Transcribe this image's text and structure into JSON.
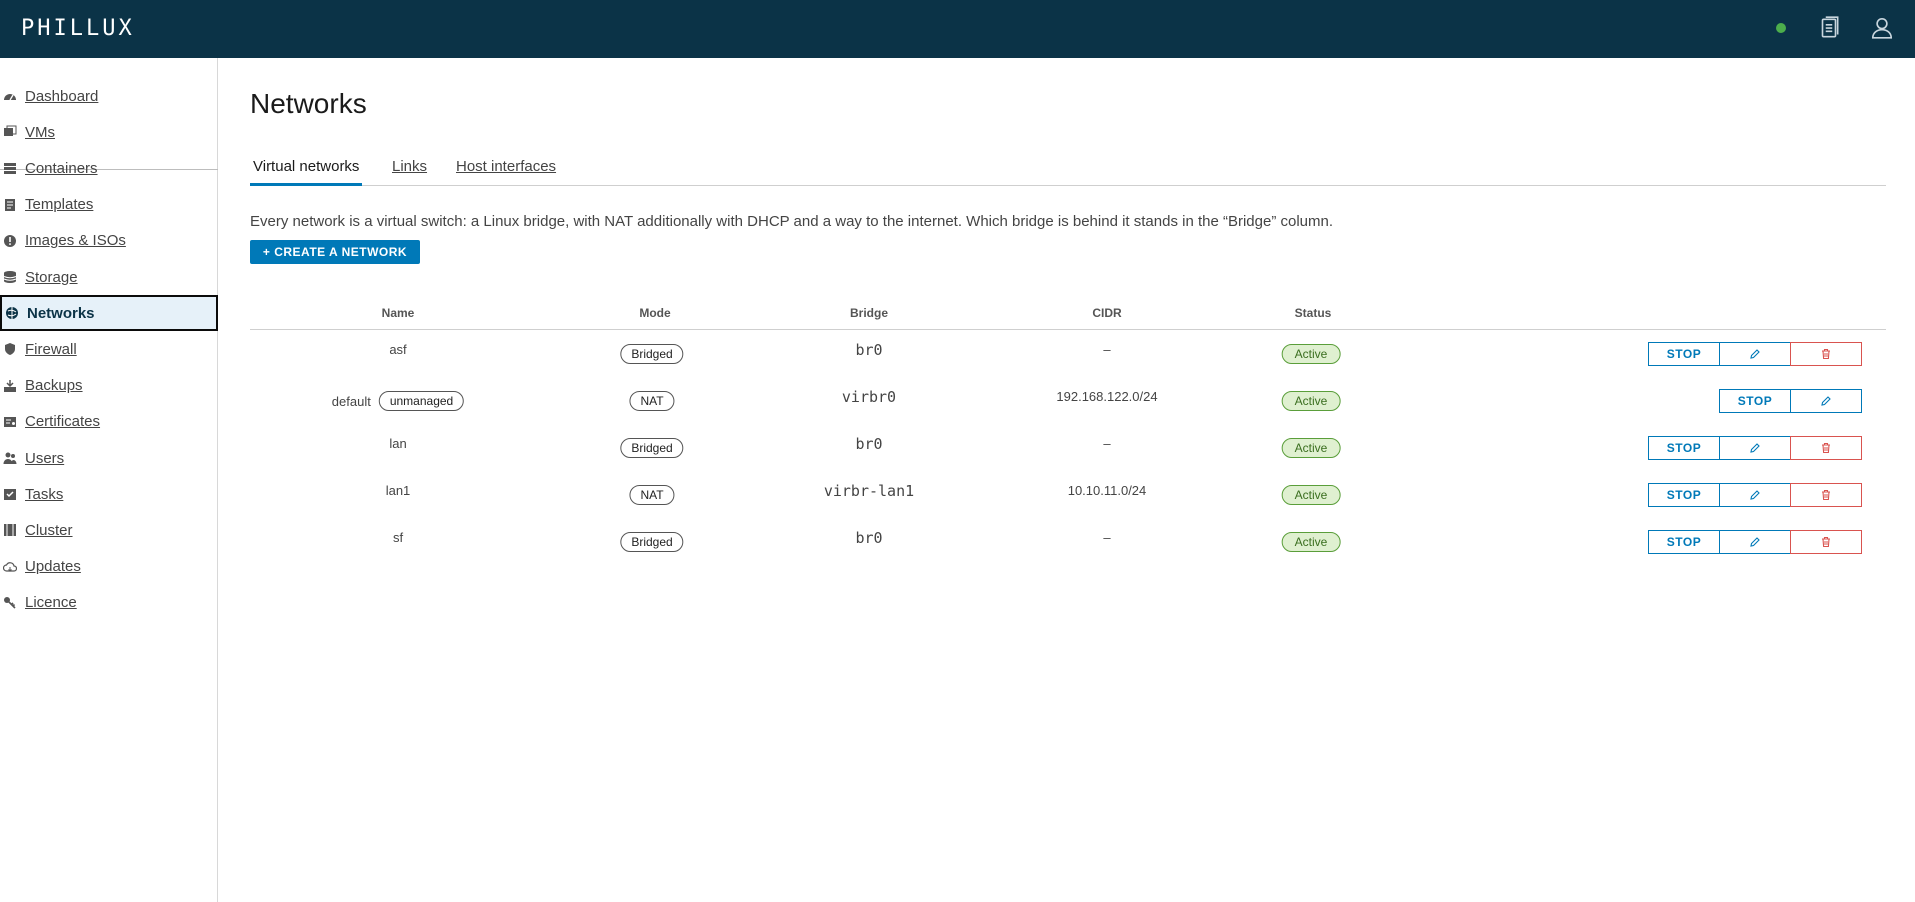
{
  "app": {
    "logo": "PHILLUX",
    "status_color": "#4cae4c"
  },
  "header_icons": [
    "documents-icon",
    "user-icon"
  ],
  "sidebar": {
    "items": [
      {
        "label": "Dashboard",
        "icon": "dashboard-icon"
      },
      {
        "label": "VMs",
        "icon": "vm-icon"
      },
      {
        "label": "Containers",
        "icon": "container-icon"
      },
      {
        "label": "Templates",
        "icon": "template-icon"
      },
      {
        "label": "Images & ISOs",
        "icon": "image-icon"
      },
      {
        "label": "Storage",
        "icon": "storage-icon"
      },
      {
        "label": "Networks",
        "icon": "network-icon",
        "active": true
      },
      {
        "label": "Firewall",
        "icon": "shield-icon"
      },
      {
        "label": "Backups",
        "icon": "backup-icon"
      },
      {
        "label": "Certificates",
        "icon": "certificate-icon"
      },
      {
        "label": "Users",
        "icon": "users-icon"
      },
      {
        "label": "Tasks",
        "icon": "tasks-icon"
      },
      {
        "label": "Cluster",
        "icon": "cluster-icon"
      },
      {
        "label": "Updates",
        "icon": "cloud-icon"
      },
      {
        "label": "Licence",
        "icon": "key-icon"
      }
    ]
  },
  "main": {
    "title": "Networks",
    "tabs": [
      {
        "label": "Virtual networks",
        "active": true
      },
      {
        "label": "Links"
      },
      {
        "label": "Host interfaces"
      }
    ],
    "description": "Every network is a virtual switch: a Linux bridge, with NAT additionally with DHCP and a way to the internet. Which bridge is behind it stands in the “Bridge” column.",
    "create_button": "+ CREATE A NETWORK"
  },
  "table": {
    "columns": [
      "Name",
      "Mode",
      "Bridge",
      "CIDR",
      "Status"
    ],
    "rows": [
      {
        "name": "asf",
        "badge": "",
        "mode": "Bridged",
        "bridge": "br0",
        "cidr": "–",
        "status": "Active",
        "actions": [
          "STOP",
          "edit",
          "delete"
        ]
      },
      {
        "name": "default",
        "badge": "unmanaged",
        "mode": "NAT",
        "bridge": "virbr0",
        "cidr": "192.168.122.0/24",
        "status": "Active",
        "actions": [
          "STOP",
          "edit"
        ]
      },
      {
        "name": "lan",
        "badge": "",
        "mode": "Bridged",
        "bridge": "br0",
        "cidr": "–",
        "status": "Active",
        "actions": [
          "STOP",
          "edit",
          "delete"
        ]
      },
      {
        "name": "lan1",
        "badge": "",
        "mode": "NAT",
        "bridge": "virbr-lan1",
        "cidr": "10.10.11.0/24",
        "status": "Active",
        "actions": [
          "STOP",
          "edit",
          "delete"
        ]
      },
      {
        "name": "sf",
        "badge": "",
        "mode": "Bridged",
        "bridge": "br0",
        "cidr": "–",
        "status": "Active",
        "actions": [
          "STOP",
          "edit",
          "delete"
        ]
      }
    ]
  },
  "colors": {
    "header_bg": "#0b3347",
    "accent": "#0079b8",
    "danger": "#d9534f",
    "active_bg": "#dff0d0"
  }
}
